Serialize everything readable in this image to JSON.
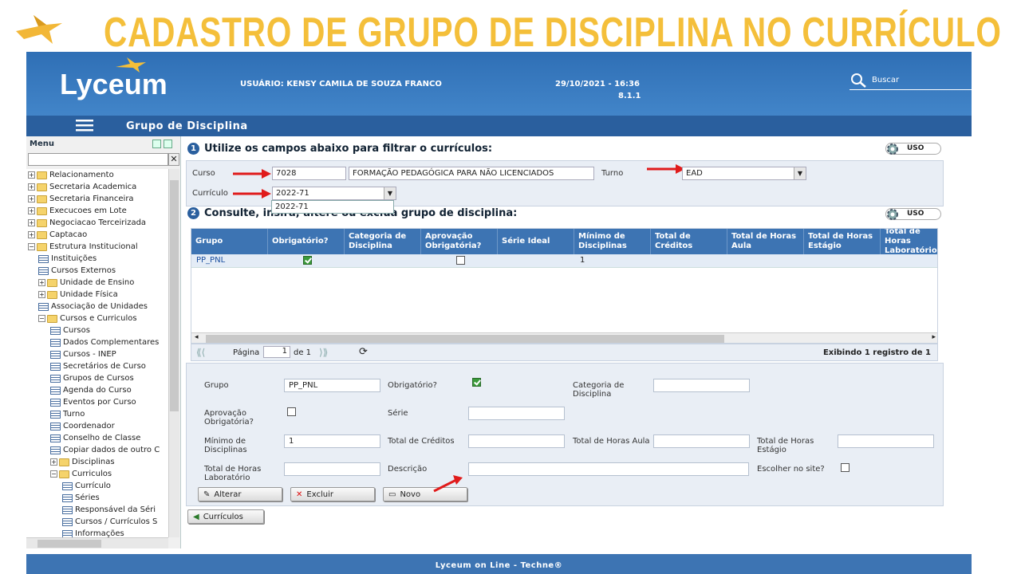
{
  "slide_title": "CADASTRO DE GRUPO DE DISCIPLINA NO CURRÍCULO",
  "header": {
    "logo": "Lyceum",
    "user_label": "USUÁRIO: KENSY CAMILA DE SOUZA FRANCO",
    "datetime": "29/10/2021 - 16:36",
    "version": "8.1.1",
    "search_label": "Buscar"
  },
  "subbar": {
    "title": "Grupo de Disciplina"
  },
  "menu": {
    "title": "Menu",
    "items": [
      {
        "label": "Relacionamento",
        "type": "folder",
        "level": 0
      },
      {
        "label": "Secretaria Academica",
        "type": "folder",
        "level": 0
      },
      {
        "label": "Secretaria Financeira",
        "type": "folder",
        "level": 0
      },
      {
        "label": "Execucoes em Lote",
        "type": "folder",
        "level": 0
      },
      {
        "label": "Negociacao Terceirizada",
        "type": "folder",
        "level": 0
      },
      {
        "label": "Captacao",
        "type": "folder",
        "level": 0
      },
      {
        "label": "Estrutura Institucional",
        "type": "folder-open",
        "level": 0
      },
      {
        "label": "Instituições",
        "type": "doc",
        "level": 1
      },
      {
        "label": "Cursos Externos",
        "type": "doc",
        "level": 1
      },
      {
        "label": "Unidade de Ensino",
        "type": "folder",
        "level": 1
      },
      {
        "label": "Unidade Física",
        "type": "folder",
        "level": 1
      },
      {
        "label": "Associação de Unidades",
        "type": "doc",
        "level": 1
      },
      {
        "label": "Cursos e Curriculos",
        "type": "folder-open",
        "level": 1
      },
      {
        "label": "Cursos",
        "type": "doc",
        "level": 2
      },
      {
        "label": "Dados Complementares",
        "type": "doc",
        "level": 2
      },
      {
        "label": "Cursos - INEP",
        "type": "doc",
        "level": 2
      },
      {
        "label": "Secretários de Curso",
        "type": "doc",
        "level": 2
      },
      {
        "label": "Grupos de Cursos",
        "type": "doc",
        "level": 2
      },
      {
        "label": "Agenda do Curso",
        "type": "doc",
        "level": 2
      },
      {
        "label": "Eventos por Curso",
        "type": "doc",
        "level": 2
      },
      {
        "label": "Turno",
        "type": "doc",
        "level": 2
      },
      {
        "label": "Coordenador",
        "type": "doc",
        "level": 2
      },
      {
        "label": "Conselho de Classe",
        "type": "doc",
        "level": 2
      },
      {
        "label": "Copiar dados de outro C",
        "type": "doc",
        "level": 2
      },
      {
        "label": "Disciplinas",
        "type": "folder",
        "level": 2
      },
      {
        "label": "Curriculos",
        "type": "folder-open",
        "level": 2
      },
      {
        "label": "Currículo",
        "type": "doc",
        "level": 3
      },
      {
        "label": "Séries",
        "type": "doc",
        "level": 3
      },
      {
        "label": "Responsável da Séri",
        "type": "doc",
        "level": 3
      },
      {
        "label": "Cursos / Currículos S",
        "type": "doc",
        "level": 3
      },
      {
        "label": "Informações",
        "type": "doc",
        "level": 3
      }
    ]
  },
  "section1": {
    "number": "1",
    "title": "Utilize os campos abaixo para filtrar o currículos:",
    "uso": "USO",
    "curso_label": "Curso",
    "curso_code": "7028",
    "curso_name": "FORMAÇÃO PEDAGÓGICA PARA NÃO LICENCIADOS",
    "turno_label": "Turno",
    "turno_value": "EAD",
    "curriculo_label": "Currículo",
    "curriculo_value": "2022-71",
    "dropdown_option": "2022-71"
  },
  "section2": {
    "number": "2",
    "title": "Consulte, insira, altere ou exclua grupo de disciplina:",
    "uso": "USO"
  },
  "grid": {
    "columns": [
      "Grupo",
      "Obrigatório?",
      "Categoria de Disciplina",
      "Aprovação Obrigatória?",
      "Série Ideal",
      "Mínimo de Disciplinas",
      "Total de Créditos",
      "Total de Horas Aula",
      "Total de Horas Estágio",
      "Total de Horas Laboratório"
    ],
    "rows": [
      {
        "grupo": "PP_PNL",
        "obrigatorio": true,
        "categoria": "",
        "aprovacao": false,
        "serie": "",
        "minimo": "1"
      }
    ]
  },
  "pager": {
    "pagina_label": "Página",
    "page": "1",
    "de_label": "de 1",
    "summary": "Exibindo 1 registro de 1"
  },
  "form": {
    "grupo_label": "Grupo",
    "grupo_value": "PP_PNL",
    "obrigatorio_label": "Obrigatório?",
    "obrigatorio_checked": true,
    "categoria_label": "Categoria de Disciplina",
    "aprovacao_label": "Aprovação Obrigatória?",
    "aprovacao_checked": false,
    "serie_label": "Série",
    "minimo_label": "Mínimo de Disciplinas",
    "minimo_value": "1",
    "creditos_label": "Total de Créditos",
    "horas_aula_label": "Total de Horas Aula",
    "horas_estagio_label": "Total de Horas Estágio",
    "horas_lab_label": "Total de Horas Laboratório",
    "descricao_label": "Descrição",
    "escolher_label": "Escolher no site?",
    "escolher_checked": false
  },
  "buttons": {
    "alterar": "Alterar",
    "excluir": "Excluir",
    "novo": "Novo",
    "curriculos": "Currículos"
  },
  "footer": "Lyceum on Line - Techne®",
  "colors": {
    "title": "#f4bf3a",
    "header": "#2f6fb5",
    "accent_arrow": "#e01b1b"
  }
}
